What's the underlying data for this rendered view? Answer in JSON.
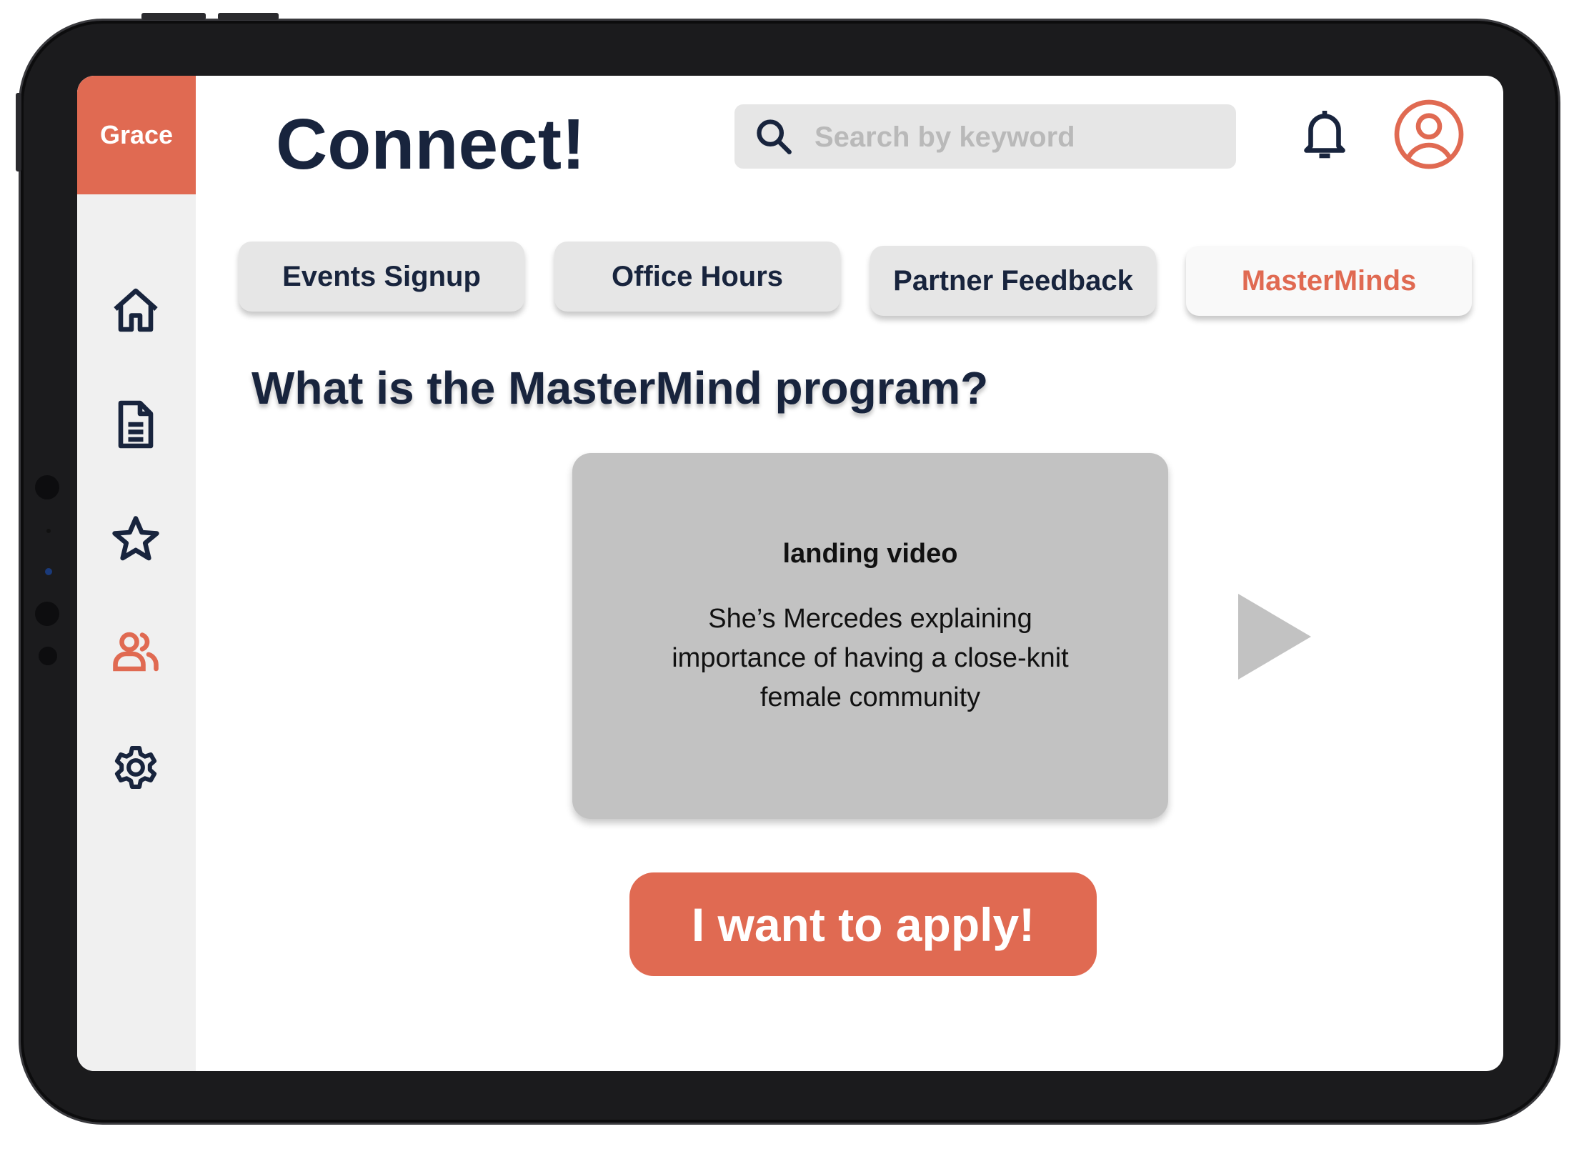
{
  "sidebar": {
    "user_name": "Grace",
    "items": [
      {
        "icon": "home-icon"
      },
      {
        "icon": "document-icon"
      },
      {
        "icon": "star-icon"
      },
      {
        "icon": "users-icon",
        "active": true
      },
      {
        "icon": "gear-icon"
      }
    ]
  },
  "header": {
    "title": "Connect!",
    "search_placeholder": "Search by keyword",
    "search_value": ""
  },
  "tabs": [
    {
      "label": "Events Signup",
      "active": false
    },
    {
      "label": "Office Hours",
      "active": false
    },
    {
      "label": "Partner Feedback",
      "active": false
    },
    {
      "label": "MasterMinds",
      "active": true
    }
  ],
  "main": {
    "heading": "What is the MasterMind program?",
    "video": {
      "title": "landing video",
      "description": "She’s Mercedes explaining importance of having a close-knit female community"
    },
    "apply_label": "I want to apply!"
  },
  "colors": {
    "accent": "#e06a52",
    "navy": "#18243d",
    "sidebar_bg": "#f0f0f0",
    "card_bg": "#c2c2c2"
  }
}
